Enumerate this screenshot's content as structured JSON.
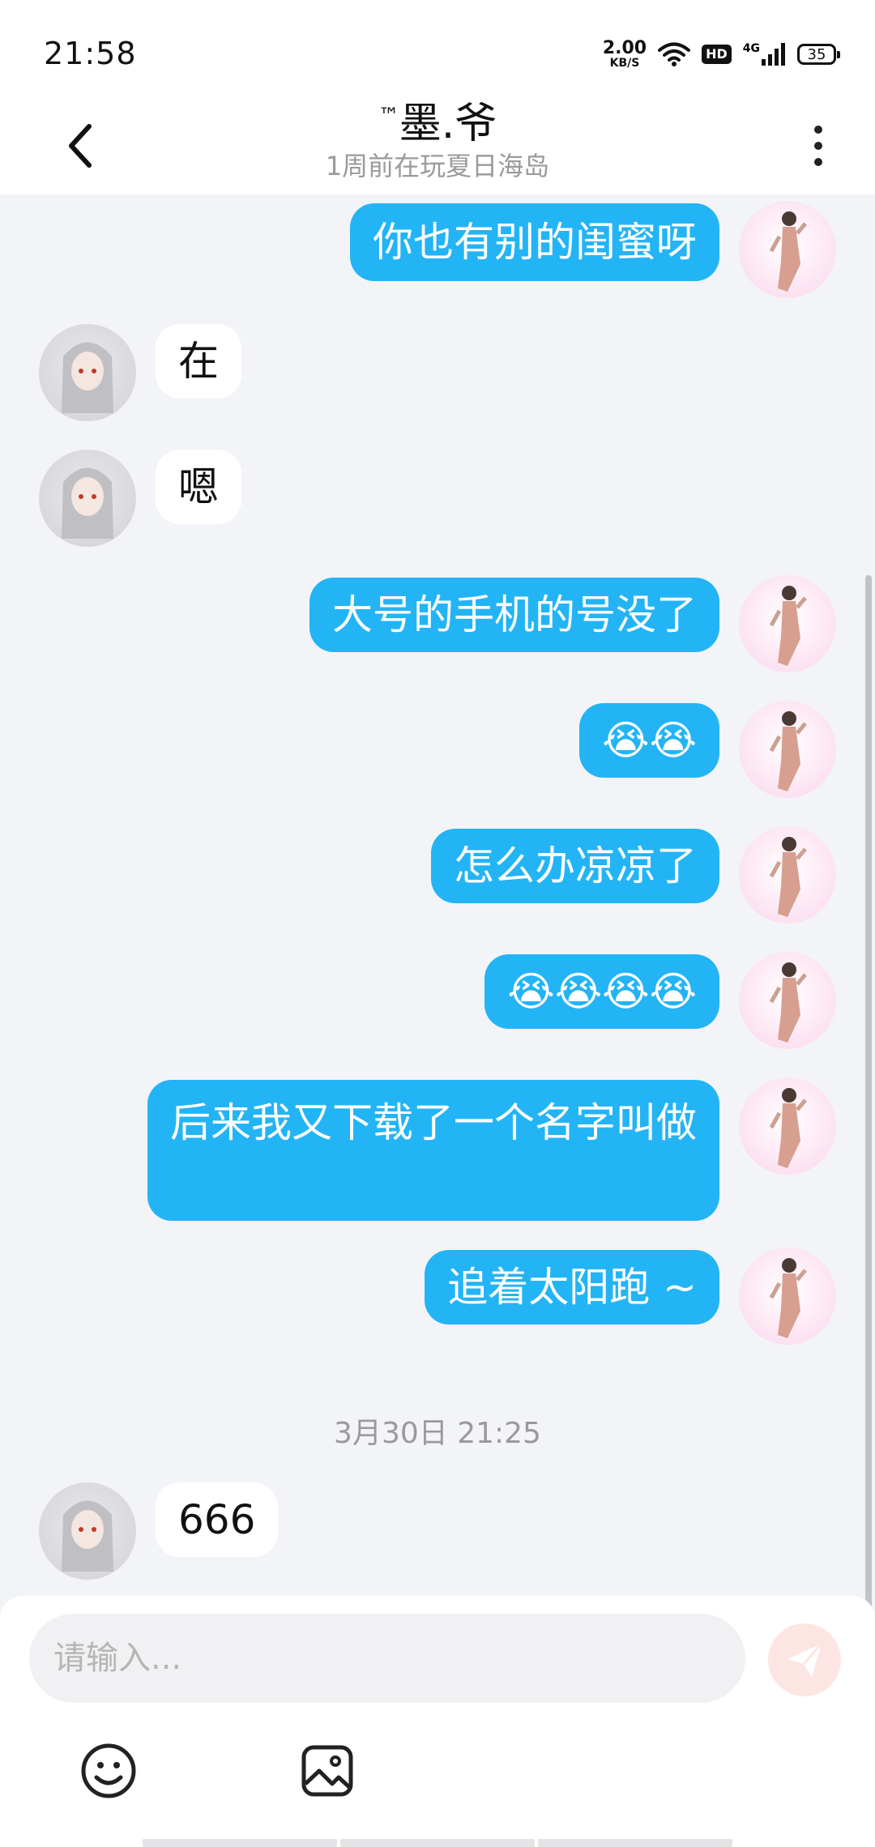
{
  "status_bar": {
    "time": "21:58",
    "net_speed_value": "2.00",
    "net_speed_unit": "KB/S",
    "hd_label": "HD",
    "network_label": "4G",
    "battery": "35"
  },
  "header": {
    "title_prefix": "™",
    "title": "墨.爷",
    "subtitle": "1周前在玩夏日海岛"
  },
  "messages": [
    {
      "side": "me",
      "text": "你也有别的闺蜜呀"
    },
    {
      "side": "other",
      "text": "在"
    },
    {
      "side": "other",
      "text": "嗯"
    },
    {
      "side": "me",
      "text": "大号的手机的号没了"
    },
    {
      "side": "me",
      "text": "😭😭"
    },
    {
      "side": "me",
      "text": "怎么办凉凉了"
    },
    {
      "side": "me",
      "text": "😭😭😭😭"
    },
    {
      "side": "me",
      "text": "后来我又下载了一个名字叫做"
    },
    {
      "side": "me",
      "text": "追着太阳跑 ~"
    },
    {
      "side": "other",
      "text": "666"
    }
  ],
  "time_separator": "3月30日 21:25",
  "composer": {
    "placeholder": "请输入...",
    "tools": [
      "smiley-icon",
      "image-icon"
    ]
  },
  "icons": {
    "back": "chevron-left-icon",
    "more": "more-vertical-icon",
    "send": "send-icon",
    "wifi": "wifi-icon",
    "signal": "signal-icon"
  },
  "colors": {
    "my_bubble": "#23b4f6",
    "other_bubble": "#ffffff",
    "background": "#f3f4f7",
    "send_disabled": "#fde5e4"
  }
}
